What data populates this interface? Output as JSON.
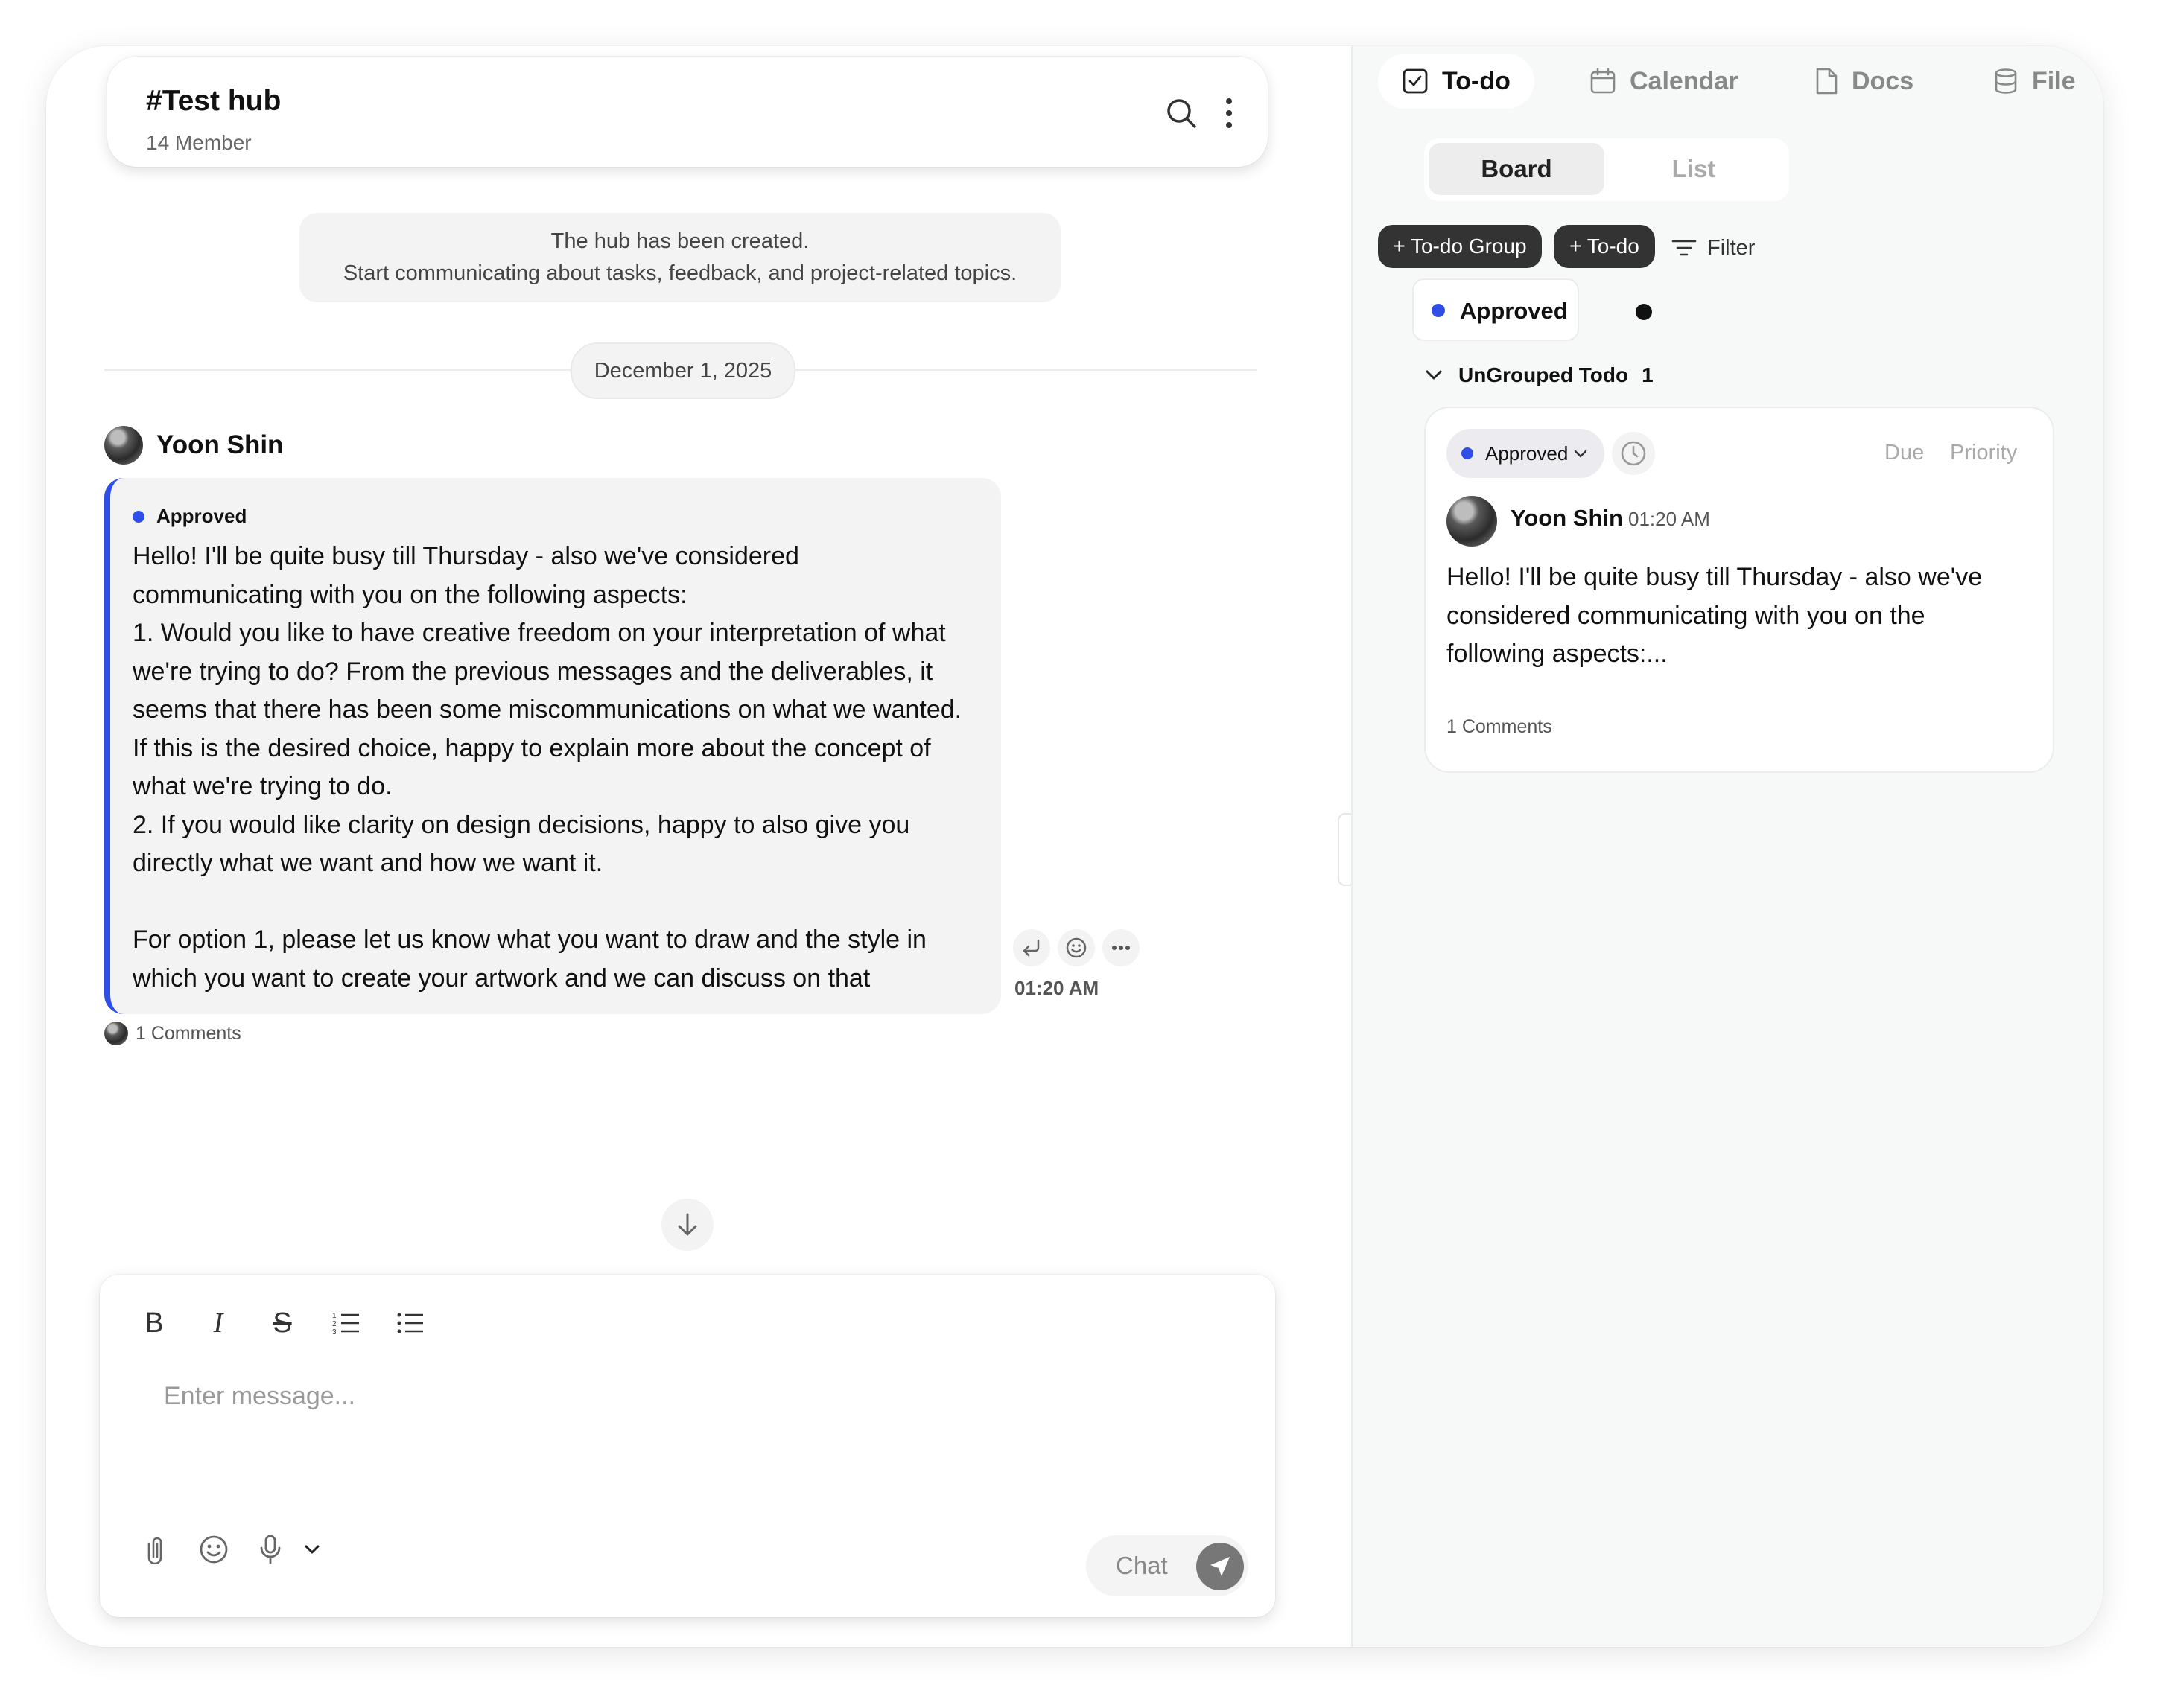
{
  "hub": {
    "title": "#Test hub",
    "members": "14 Member"
  },
  "system_message": {
    "line1": "The hub has been created.",
    "line2": "Start communicating about tasks, feedback, and project-related topics."
  },
  "date_separator": "December 1, 2025",
  "message": {
    "sender": "Yoon Shin",
    "status": "Approved",
    "status_color": "#2f4ee8",
    "lines": [
      "Hello! I'll be quite busy till Thursday - also we've considered",
      "communicating with you on the following aspects:",
      "1. Would you like to have creative freedom on your interpretation of what",
      "we're trying to do? From the previous messages and the deliverables, it",
      "seems that there has been some miscommunications on what we wanted.",
      "If this is the desired choice, happy to explain more about the concept of",
      "what we're trying to do.",
      "2. If you would like clarity on design decisions, happy to also give you",
      "directly what we want and how we want it.",
      "",
      "For option 1, please let us know what you want to draw and the style in",
      "which you want to create your artwork and we can discuss on that"
    ],
    "time": "01:20 AM",
    "comments": "1 Comments",
    "actions": [
      "reply-icon",
      "emoji-icon",
      "more-icon"
    ]
  },
  "composer": {
    "placeholder": "Enter message...",
    "format_tools": [
      "bold-icon",
      "italic-icon",
      "strikethrough-icon",
      "ordered-list-icon",
      "bullet-list-icon"
    ],
    "bottom_tools": [
      "attach-icon",
      "emoji-icon",
      "microphone-icon",
      "chevron-down-icon"
    ],
    "send_label": "Chat"
  },
  "right_panel": {
    "tabs": [
      {
        "label": "To-do",
        "icon": "checkbox-icon",
        "active": true
      },
      {
        "label": "Calendar",
        "icon": "calendar-icon",
        "active": false
      },
      {
        "label": "Docs",
        "icon": "document-icon",
        "active": false
      },
      {
        "label": "File",
        "icon": "database-icon",
        "active": false
      }
    ],
    "view_toggle": {
      "board": "Board",
      "list": "List",
      "selected": "Board"
    },
    "buttons": {
      "add_group": "+ To-do Group",
      "add_todo": "+ To-do",
      "filter": "Filter"
    },
    "status_filter": "Approved",
    "group": {
      "label": "UnGrouped Todo",
      "count": "1"
    },
    "card": {
      "status": "Approved",
      "due": "Due",
      "priority": "Priority",
      "author": "Yoon Shin",
      "time": "01:20 AM",
      "lines": [
        "Hello! I'll be quite busy till Thursday - also we've",
        "considered communicating with you on the",
        "following aspects:..."
      ],
      "comments": "1 Comments"
    }
  }
}
